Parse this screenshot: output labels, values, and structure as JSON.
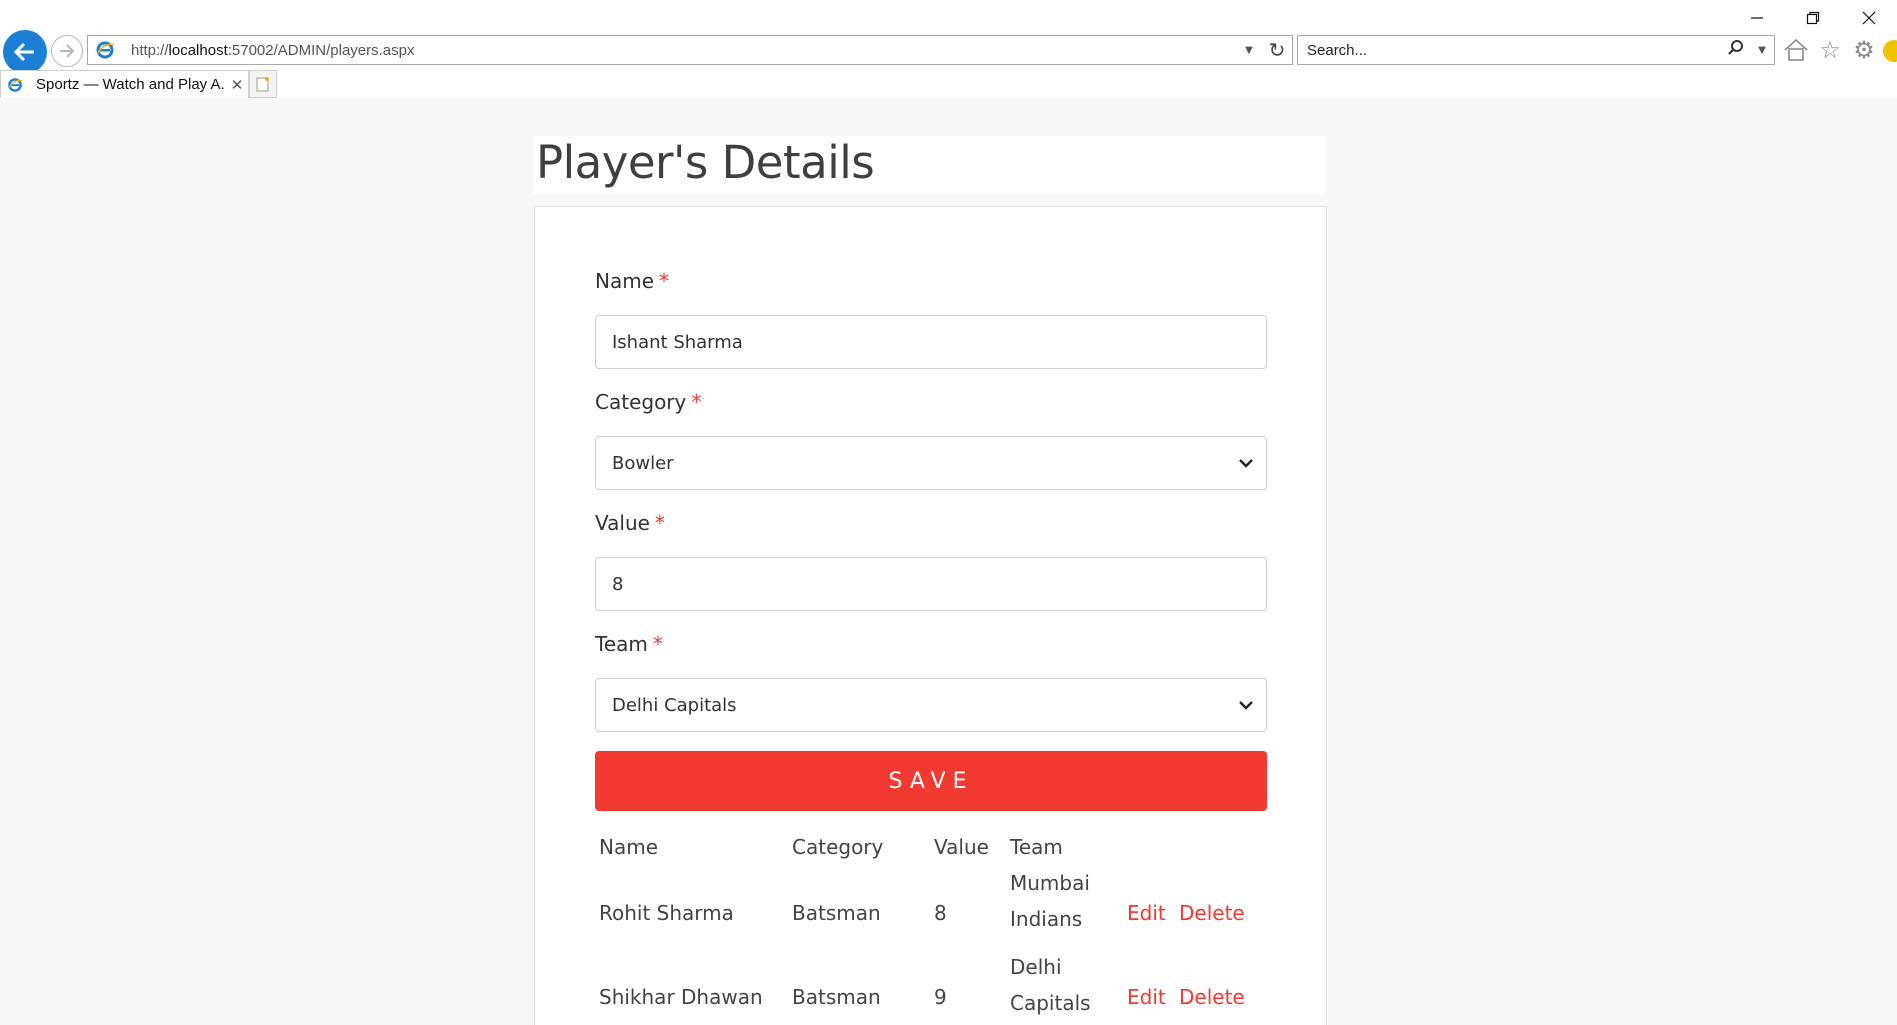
{
  "browser": {
    "url_prefix": "http://",
    "url_host": "localhost",
    "url_rest": ":57002/ADMIN/players.aspx",
    "search_placeholder": "Search...",
    "tab_title": "Sportz — Watch and Play A...",
    "icons": [
      "back-arrow-icon",
      "forward-arrow-icon",
      "ie-logo-icon",
      "refresh-icon",
      "search-icon",
      "home-icon",
      "star-icon",
      "gear-icon",
      "smiley-icon"
    ]
  },
  "page": {
    "title": "Player's Details"
  },
  "form": {
    "name_label": "Name",
    "name_value": "Ishant Sharma",
    "category_label": "Category",
    "category_value": "Bowler",
    "value_label": "Value",
    "value_value": "8",
    "team_label": "Team",
    "team_value": "Delhi Capitals",
    "required_mark": "*",
    "save_label": "SAVE"
  },
  "table": {
    "headers": [
      "Name",
      "Category",
      "Value",
      "Team"
    ],
    "rows": [
      {
        "name": "Rohit Sharma",
        "category": "Batsman",
        "value": "8",
        "team_line1": "Mumbai",
        "team_line2": "Indians",
        "edit": "Edit",
        "delete": "Delete"
      },
      {
        "name": "Shikhar Dhawan",
        "category": "Batsman",
        "value": "9",
        "team_line1": "Delhi",
        "team_line2": "Capitals",
        "edit": "Edit",
        "delete": "Delete"
      }
    ]
  },
  "colors": {
    "accent": "#f23a30",
    "ie_blue": "#1b7fd6"
  }
}
